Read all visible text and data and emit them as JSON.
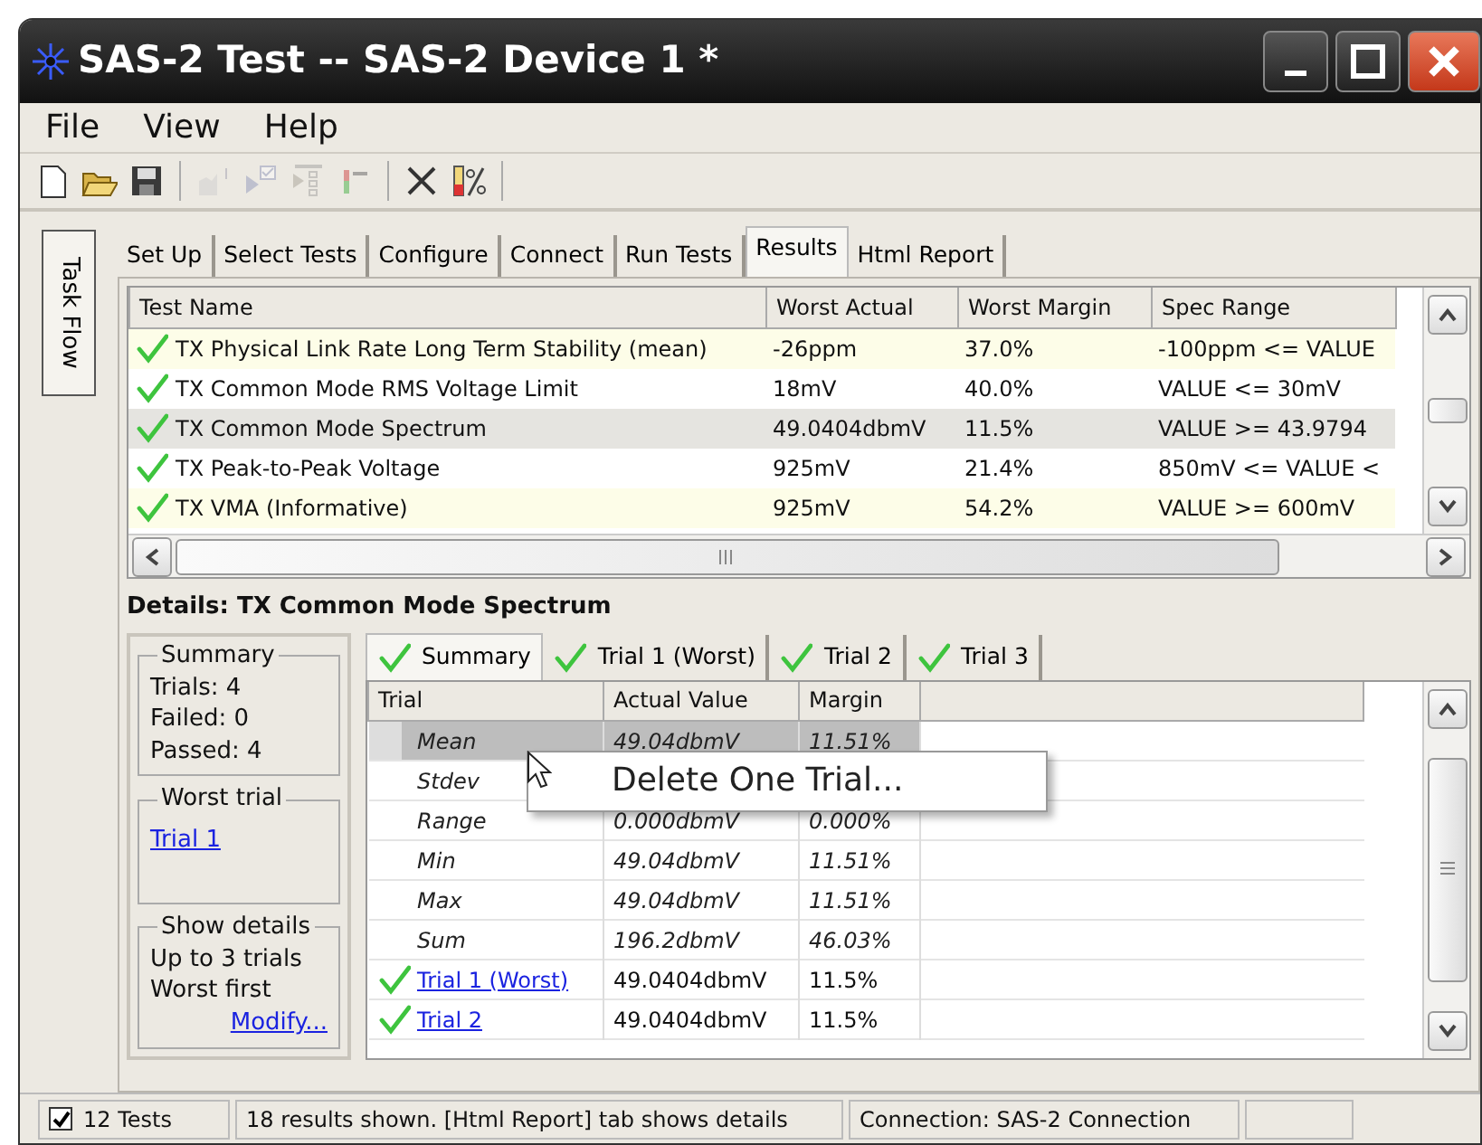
{
  "window": {
    "title": "SAS-2 Test -- SAS-2 Device 1 *"
  },
  "menu": [
    "File",
    "View",
    "Help"
  ],
  "toolbar": [
    {
      "kind": "new",
      "disabled": false
    },
    {
      "kind": "open",
      "disabled": false
    },
    {
      "kind": "save",
      "disabled": false
    },
    {
      "kind": "sep"
    },
    {
      "kind": "chart",
      "disabled": true
    },
    {
      "kind": "run-check",
      "disabled": true
    },
    {
      "kind": "run-list",
      "disabled": true
    },
    {
      "kind": "bars",
      "disabled": true
    },
    {
      "kind": "sep"
    },
    {
      "kind": "delete",
      "disabled": false
    },
    {
      "kind": "percent",
      "disabled": false
    },
    {
      "kind": "sep"
    }
  ],
  "task_flow": {
    "label": "Task Flow"
  },
  "tabs": [
    {
      "label": "Set Up",
      "selected": false
    },
    {
      "label": "Select Tests",
      "selected": false
    },
    {
      "label": "Configure",
      "selected": false
    },
    {
      "label": "Connect",
      "selected": false
    },
    {
      "label": "Run Tests",
      "selected": false
    },
    {
      "label": "Results",
      "selected": true
    },
    {
      "label": "Html Report",
      "selected": false
    }
  ],
  "results": {
    "columns": [
      "Test Name",
      "Worst Actual",
      "Worst Margin",
      "Spec Range"
    ],
    "rows": [
      {
        "passed": true,
        "selected": false,
        "cells": [
          "TX Physical Link Rate Long Term Stability (mean)",
          "-26ppm",
          "37.0%",
          "-100ppm <= VALUE"
        ]
      },
      {
        "passed": true,
        "selected": false,
        "cells": [
          "TX Common Mode RMS Voltage Limit",
          "18mV",
          "40.0%",
          "VALUE <= 30mV"
        ]
      },
      {
        "passed": true,
        "selected": true,
        "cells": [
          "TX Common Mode Spectrum",
          "49.0404dbmV",
          "11.5%",
          "VALUE >= 43.9794"
        ]
      },
      {
        "passed": true,
        "selected": false,
        "cells": [
          "TX Peak-to-Peak Voltage",
          "925mV",
          "21.4%",
          "850mV <= VALUE <"
        ]
      },
      {
        "passed": true,
        "selected": false,
        "cells": [
          "TX VMA (Informative)",
          "925mV",
          "54.2%",
          "VALUE >= 600mV"
        ]
      }
    ]
  },
  "details": {
    "title": "Details: TX Common Mode Spectrum",
    "summary": {
      "legend": "Summary",
      "lines": [
        "Trials: 4",
        "Failed: 0",
        "Passed: 4"
      ]
    },
    "worst_trial": {
      "legend": "Worst trial",
      "link": "Trial 1"
    },
    "show_details": {
      "legend": "Show details",
      "lines": [
        "Up to 3 trials",
        "Worst first"
      ],
      "link": "Modify..."
    },
    "tabs": [
      {
        "label": "Summary",
        "passed": true,
        "selected": true
      },
      {
        "label": "Trial 1 (Worst)",
        "passed": true,
        "selected": false
      },
      {
        "label": "Trial 2",
        "passed": true,
        "selected": false
      },
      {
        "label": "Trial 3",
        "passed": true,
        "selected": false
      }
    ],
    "grid": {
      "columns": [
        "Trial",
        "Actual Value",
        "Margin"
      ],
      "rows": [
        {
          "kind": "stat",
          "selected": true,
          "cells": [
            "Mean",
            "49.04dbmV",
            "11.51%"
          ]
        },
        {
          "kind": "stat",
          "selected": false,
          "cells": [
            "Stdev",
            "",
            ""
          ]
        },
        {
          "kind": "stat",
          "selected": false,
          "cells": [
            "Range",
            "0.000dbmV",
            "0.000%"
          ]
        },
        {
          "kind": "stat",
          "selected": false,
          "cells": [
            "Min",
            "49.04dbmV",
            "11.51%"
          ]
        },
        {
          "kind": "stat",
          "selected": false,
          "cells": [
            "Max",
            "49.04dbmV",
            "11.51%"
          ]
        },
        {
          "kind": "stat",
          "selected": false,
          "cells": [
            "Sum",
            "196.2dbmV",
            "46.03%"
          ]
        },
        {
          "kind": "trial",
          "passed": true,
          "selected": false,
          "cells": [
            "Trial 1 (Worst)",
            "49.0404dbmV",
            "11.5%"
          ]
        },
        {
          "kind": "trial",
          "passed": true,
          "selected": false,
          "cells": [
            "Trial 2",
            "49.0404dbmV",
            "11.5%"
          ]
        }
      ]
    },
    "context_menu": [
      "Delete One Trial..."
    ]
  },
  "status_bar": {
    "checked": true,
    "count": "12 Tests",
    "message": "18 results shown. [Html Report] tab shows details",
    "connection": "Connection: SAS-2 Connection"
  }
}
